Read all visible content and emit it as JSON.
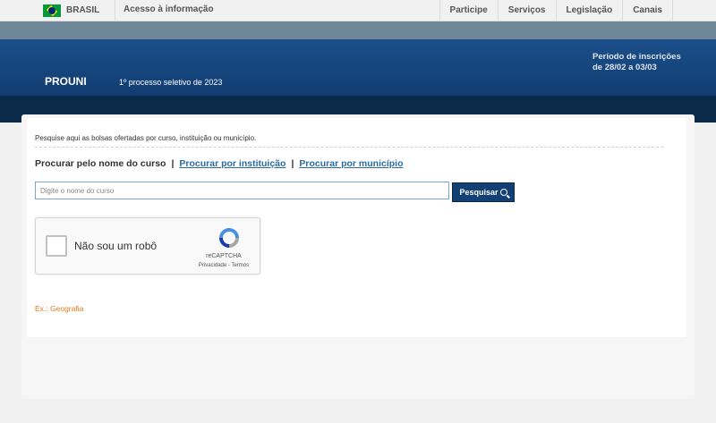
{
  "govbar": {
    "brasil_label": "BRASIL",
    "acesso_label": "Acesso à informação",
    "nav": [
      "Participe",
      "Serviços",
      "Legislação",
      "Canais"
    ]
  },
  "header": {
    "title": "PROUNI",
    "subtitle": "1º processo seletivo de 2023",
    "periodo_line1": "Período de inscrições",
    "periodo_line2": "de 28/02 a 03/03"
  },
  "main": {
    "intro": "Pesquise aqui as bolsas ofertadas por curso, instituição ou município.",
    "mode_active": "Procurar pelo nome do curso",
    "mode_instituicao": "Procurar por instituição",
    "mode_municipio": "Procurar por município",
    "search_placeholder": "Digite o nome do curso",
    "search_value": "",
    "search_button": "Pesquisar",
    "example": "Ex.: Geografia"
  },
  "recaptcha": {
    "label": "Não sou um robô",
    "brand": "reCAPTCHA",
    "privacy": "Privacidade",
    "terms_sep": " - ",
    "terms": "Termos"
  },
  "colors": {
    "header_blue": "#123f74",
    "link_blue": "#2b6ba0",
    "example_orange": "#e07b1a"
  }
}
